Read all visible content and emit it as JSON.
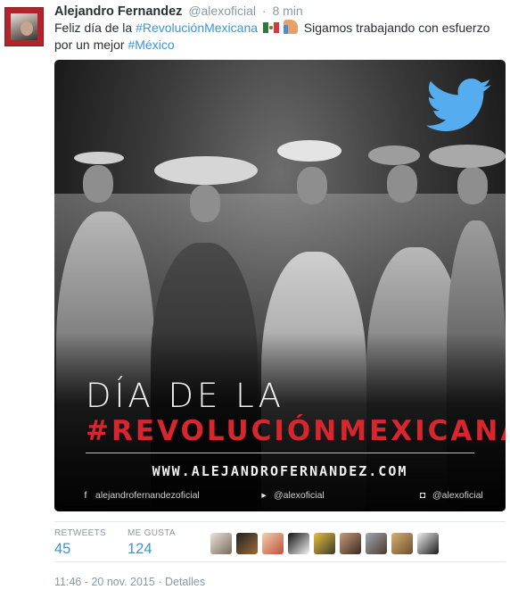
{
  "tweet": {
    "author_name": "Alejandro Fernandez",
    "author_handle": "@alexoficial",
    "separator": "·",
    "time_ago": "8 min",
    "text": {
      "part1": "Feliz día de la ",
      "hashtag1": "#RevoluciónMexicana",
      "part2": " Sigamos trabajando con esfuerzo por un mejor ",
      "hashtag2": "#México"
    },
    "emojis": [
      "mexico-flag",
      "thumbs-up"
    ]
  },
  "media": {
    "headline_line1": "DÍA DE LA",
    "headline_line2": "#REVOLUCIÓNMEXICANA",
    "website": "WWW.ALEJANDROFERNANDEZ.COM",
    "facebook_label": "alejandrofernandezoficial",
    "twitter_label": "@alexoficial",
    "instagram_label": "@alexoficial",
    "icons": [
      "twitter-bird-icon",
      "facebook-icon",
      "twitter-icon",
      "instagram-icon"
    ]
  },
  "stats": {
    "retweets_label": "RETWEETS",
    "retweets_value": "45",
    "likes_label": "ME GUSTA",
    "likes_value": "124"
  },
  "footer": {
    "timestamp": "11:46 - 20 nov. 2015",
    "separator": "·",
    "details": "Detalles"
  },
  "colors": {
    "link": "#3b94d9",
    "muted": "#8899a6",
    "accent_red": "#d8262e",
    "twitter_blue": "#55acee"
  }
}
